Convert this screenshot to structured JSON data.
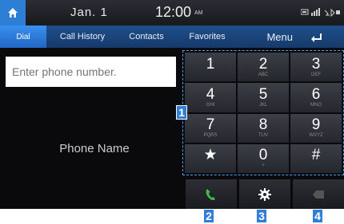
{
  "status_bar": {
    "date": "Jan.  1",
    "time": "12:00",
    "ampm": "AM"
  },
  "tabs": [
    {
      "label": "Dial",
      "active": true
    },
    {
      "label": "Call History"
    },
    {
      "label": "Contacts"
    },
    {
      "label": "Favorites"
    },
    {
      "label": "Menu"
    }
  ],
  "input": {
    "placeholder": "Enter phone number.",
    "value": ""
  },
  "phone_name": "Phone Name",
  "keypad": [
    {
      "digit": "1",
      "letters": ""
    },
    {
      "digit": "2",
      "letters": "ABC"
    },
    {
      "digit": "3",
      "letters": "DEF"
    },
    {
      "digit": "4",
      "letters": "GHI"
    },
    {
      "digit": "5",
      "letters": "JKL"
    },
    {
      "digit": "6",
      "letters": "MNO"
    },
    {
      "digit": "7",
      "letters": "PQRS"
    },
    {
      "digit": "8",
      "letters": "TUV"
    },
    {
      "digit": "9",
      "letters": "WXYZ"
    },
    {
      "digit": "★",
      "letters": ""
    },
    {
      "digit": "0",
      "letters": "+"
    },
    {
      "digit": "#",
      "letters": ""
    }
  ],
  "actions": [
    {
      "icon": "call-icon",
      "color": "#3fbf4a"
    },
    {
      "icon": "gear-icon",
      "color": "#ffffff"
    },
    {
      "icon": "backspace-icon",
      "color": "#555555"
    }
  ],
  "callouts": [
    "1",
    "2",
    "3",
    "4"
  ],
  "colors": {
    "accent": "#2d7fd6",
    "tab_bar": "#1f4f8c",
    "call_green": "#3fbf4a",
    "keypad_outline": "#4aa3ff"
  }
}
